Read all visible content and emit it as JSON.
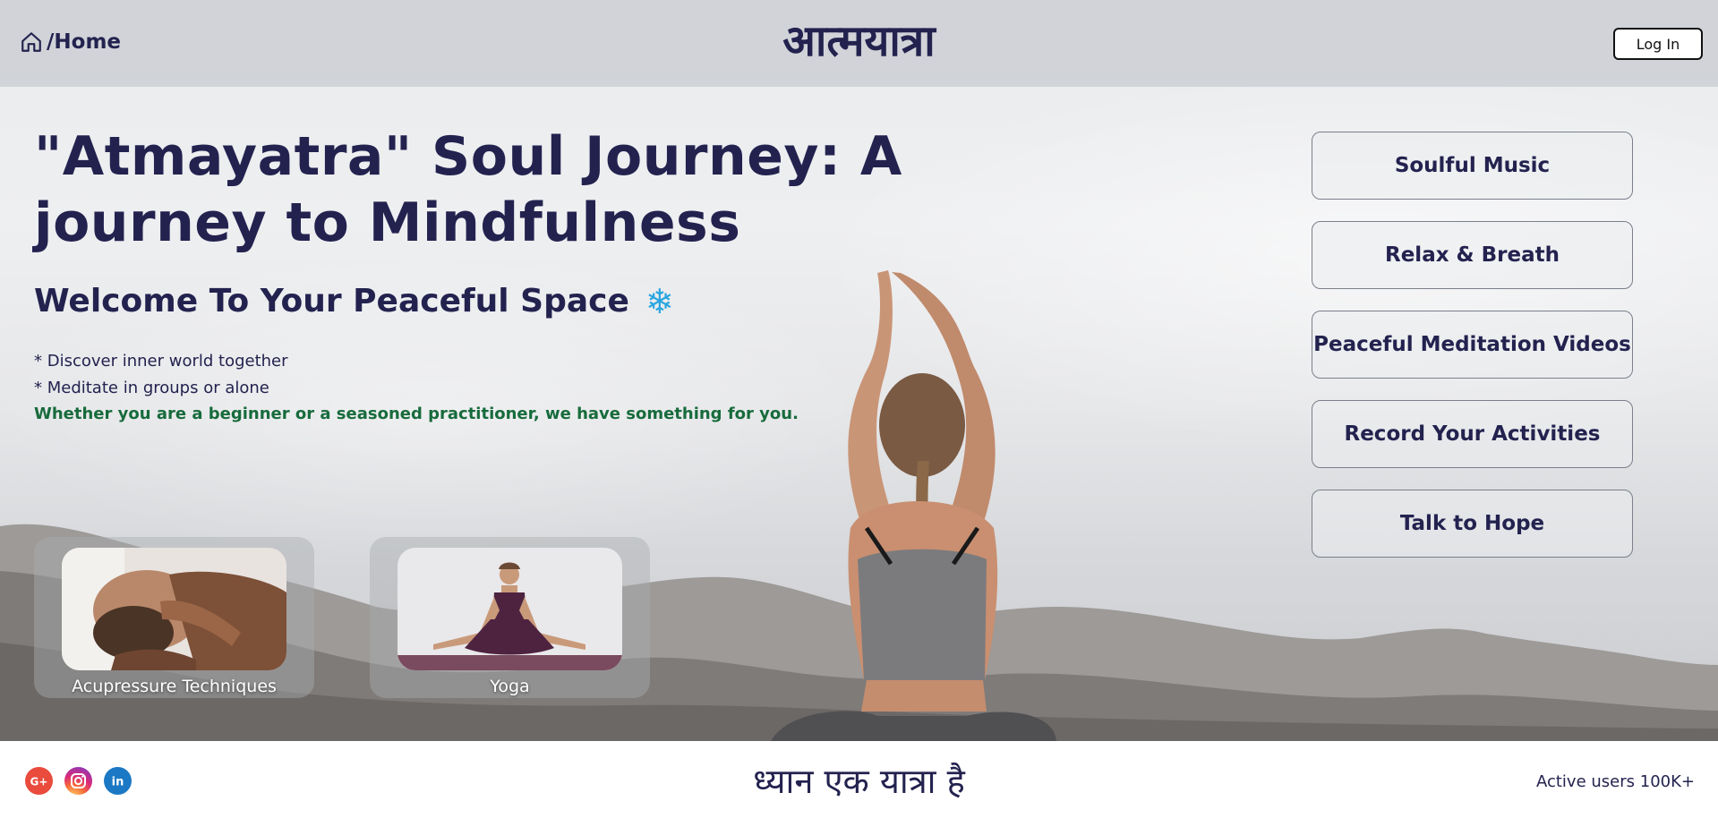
{
  "header": {
    "home_label": "/Home",
    "brand": "आत्मयात्रा",
    "login_label": "Log In"
  },
  "main": {
    "title": "\"Atmayatra\" Soul Journey: A journey to Mindfulness",
    "subtitle": "Welcome To Your Peaceful Space",
    "subtitle_icon": "❄",
    "bullets": [
      "* Discover inner world together",
      "* Meditate in groups or alone"
    ],
    "tagline": "Whether you are a beginner or a seasoned practitioner, we have something for you."
  },
  "cards": [
    {
      "label": "Acupressure Techniques",
      "icon": "acupressure-photo"
    },
    {
      "label": "Yoga",
      "icon": "yoga-photo"
    }
  ],
  "menu": [
    {
      "label": "Soulful Music"
    },
    {
      "label": "Relax & Breath"
    },
    {
      "label": "Peaceful Meditation Videos"
    },
    {
      "label": "Record Your Activities"
    },
    {
      "label": "Talk to Hope"
    }
  ],
  "footer": {
    "social": [
      "google-plus-icon",
      "instagram-icon",
      "linkedin-icon"
    ],
    "motto": "ध्यान एक यात्रा है",
    "active_users": "Active users 100K+"
  },
  "colors": {
    "primary_text": "#23224f",
    "tagline": "#176b3c",
    "snowflake": "#2aa6e0",
    "google": "#e94b3c",
    "linkedin": "#1b78c4"
  }
}
